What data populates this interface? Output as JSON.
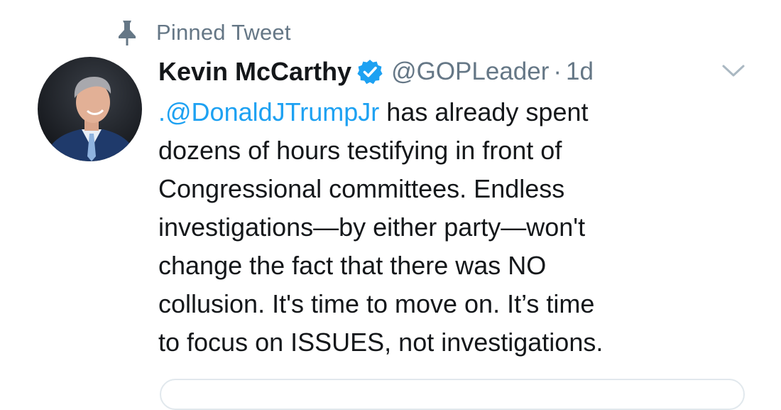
{
  "pinned": {
    "label": "Pinned Tweet",
    "icon": "pin-icon"
  },
  "tweet": {
    "avatar_icon": "avatar-photo",
    "display_name": "Kevin McCarthy",
    "verified_icon": "verified-badge-icon",
    "handle": "@GOPLeader",
    "separator": "·",
    "time": "1d",
    "menu_icon": "chevron-down-icon",
    "body": {
      "mention": ".@DonaldJTrumpJr",
      "line1_rest": " has already spent",
      "line2": "dozens of hours testifying in front of",
      "line3": "Congressional committees. Endless",
      "line4": "investigations—by either party—won't",
      "line5": "change the fact that there was NO",
      "line6": "collusion. It's time to move on. It’s time",
      "line7": "to focus on ISSUES, not investigations."
    }
  },
  "colors": {
    "text": "#14171a",
    "secondary": "#657786",
    "link": "#1da1f2",
    "verified": "#1da1f2",
    "border": "#e1e8ed"
  }
}
